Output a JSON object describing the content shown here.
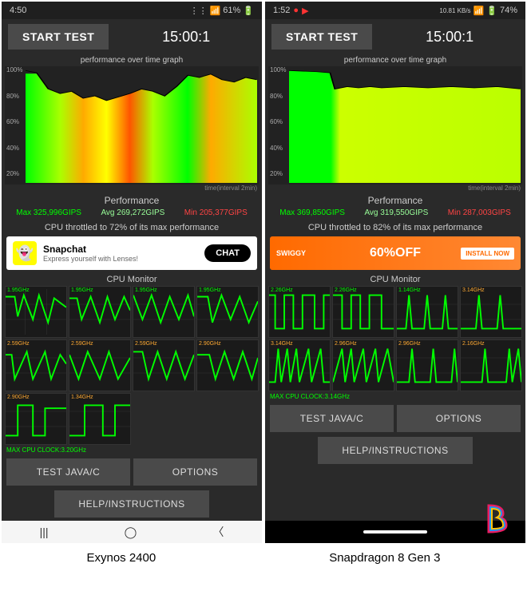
{
  "left": {
    "status": {
      "time": "4:50",
      "battery": "61%"
    },
    "start_label": "START TEST",
    "timer": "15:00:1",
    "graph_title": "performance over time graph",
    "y_ticks": [
      "100%",
      "80%",
      "60%",
      "40%",
      "20%"
    ],
    "time_label": "time(interval 2min)",
    "perf_title": "Performance",
    "stats": {
      "max": "Max 325,996GIPS",
      "avg": "Avg 269,272GIPS",
      "min": "Min 205,377GIPS"
    },
    "throttle": "CPU throttled to 72% of its max performance",
    "ad": {
      "title": "Snapchat",
      "subtitle": "Express yourself with Lenses!",
      "cta": "CHAT"
    },
    "cpu_title": "CPU Monitor",
    "cpu_freqs": [
      "1.95GHz",
      "1.95GHz",
      "1.95GHz",
      "1.95GHz",
      "2.59GHz",
      "2.59GHz",
      "2.59GHz",
      "2.90GHz",
      "2.90GHz",
      "1.34GHz"
    ],
    "max_clock": "MAX CPU CLOCK:3.20GHz",
    "btn_test": "TEST JAVA/C",
    "btn_options": "OPTIONS",
    "btn_help": "HELP/INSTRUCTIONS",
    "caption": "Exynos 2400"
  },
  "right": {
    "status": {
      "time": "1:52",
      "battery": "74%",
      "net": "10.81 KB/s"
    },
    "start_label": "START TEST",
    "timer": "15:00:1",
    "graph_title": "performance over time graph",
    "y_ticks": [
      "100%",
      "80%",
      "60%",
      "40%",
      "20%"
    ],
    "time_label": "time(interval 2min)",
    "perf_title": "Performance",
    "stats": {
      "max": "Max 369,850GIPS",
      "avg": "Avg 319,550GIPS",
      "min": "Min 287,003GIPS"
    },
    "throttle": "CPU throttled to 82% of its max performance",
    "ad": {
      "brand": "SWIGGY",
      "main": "60%OFF",
      "cta": "INSTALL NOW"
    },
    "cpu_title": "CPU Monitor",
    "cpu_freqs": [
      "2.26GHz",
      "2.26GHz",
      "1.14GHz",
      "3.14GHz",
      "3.14GHz",
      "2.96GHz",
      "2.96GHz",
      "2.16GHz"
    ],
    "max_clock": "MAX CPU CLOCK:3.14GHz",
    "btn_test": "TEST JAVA/C",
    "btn_options": "OPTIONS",
    "btn_help": "HELP/INSTRUCTIONS",
    "caption": "Snapdragon 8 Gen 3"
  },
  "chart_data": [
    {
      "type": "line",
      "title": "performance over time graph (Exynos 2400)",
      "ylabel": "Performance %",
      "ylim": [
        0,
        100
      ],
      "x_note": "time(interval 2min) over 15:00",
      "series": [
        {
          "name": "perf_pct_estimate",
          "values": [
            100,
            96,
            82,
            78,
            80,
            74,
            76,
            72,
            75,
            78,
            82,
            80,
            76,
            84,
            94,
            92,
            95,
            90,
            88,
            92,
            90,
            87,
            86,
            84,
            85
          ]
        }
      ],
      "summary": {
        "max_gips": 325996,
        "avg_gips": 269272,
        "min_gips": 205377,
        "throttle_pct": 72
      }
    },
    {
      "type": "line",
      "title": "performance over time graph (Snapdragon 8 Gen 3)",
      "ylabel": "Performance %",
      "ylim": [
        0,
        100
      ],
      "x_note": "time(interval 2min) over 15:00",
      "series": [
        {
          "name": "perf_pct_estimate",
          "values": [
            100,
            98,
            96,
            82,
            84,
            83,
            84,
            83,
            84,
            82,
            84,
            83,
            84,
            82,
            83,
            84,
            82,
            83,
            84,
            82,
            83,
            84,
            82,
            83,
            82
          ]
        }
      ],
      "summary": {
        "max_gips": 369850,
        "avg_gips": 319550,
        "min_gips": 287003,
        "throttle_pct": 82
      }
    }
  ]
}
